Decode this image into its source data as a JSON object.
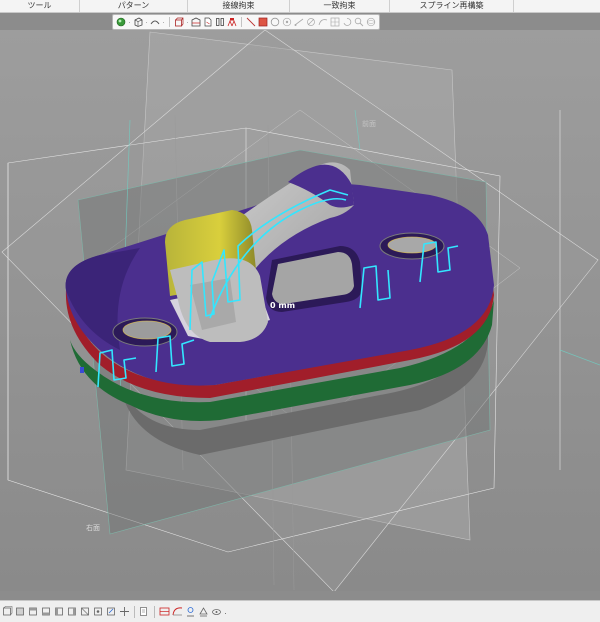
{
  "ribbon": {
    "tabs": [
      "ツール",
      "パターン",
      "接線拘束",
      "一致拘束",
      "スプライン再構築"
    ]
  },
  "floating_toolbar": {
    "icons": [
      "sphere-icon",
      "box-view-icon",
      "arc-icon",
      "cube-icon",
      "section-icon",
      "drawing-icon",
      "pause-icon",
      "assembly-icon",
      "line-icon",
      "rectangle-select-icon",
      "circle-icon",
      "target-icon",
      "measure-icon",
      "snap-icon",
      "curve-icon",
      "grid-icon",
      "rotate-icon",
      "zoom-icon",
      "sphere-snap-icon"
    ]
  },
  "viewport": {
    "plane_label_top": "前面",
    "plane_label_right": "右面",
    "dimension_label": "0 mm"
  },
  "bottom_toolbar": {
    "icons": [
      "view-front-icon",
      "view-back-icon",
      "view-top-icon",
      "view-bottom-icon",
      "view-left-icon",
      "view-right-icon",
      "view-iso-icon",
      "view-normal-icon",
      "view-fit-icon",
      "view-pan-icon",
      "sketch-icon",
      "display-mode-icon",
      "edge-icon",
      "curvature-icon",
      "wrap-icon",
      "camera-icon"
    ]
  },
  "colors": {
    "part_top": "#4b2f8e",
    "part_dark": "#3a2270",
    "rim_red": "#a11e2a",
    "side_green": "#1f6b35",
    "base_gray": "#6b6b6b",
    "highlight_cyan": "#33e6ff",
    "clip_yellow": "#d9cf3c"
  }
}
